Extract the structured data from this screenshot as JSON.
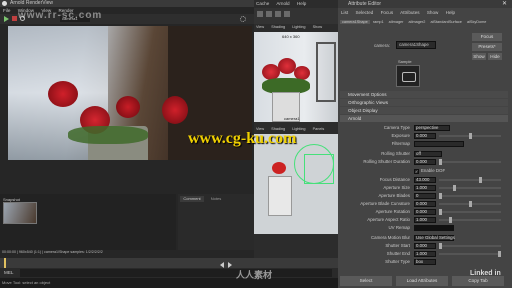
{
  "watermark": {
    "main": "www.cg-ku.com",
    "top_left": "www.rr-sc.com",
    "bottom_center": "人人素材",
    "corner": "Linked in"
  },
  "render_view": {
    "title": "Arnold RenderView",
    "menus": [
      "File",
      "Window",
      "View",
      "Render"
    ],
    "camera": "camera1",
    "status": "00:00:00 | 960x540 (1:1) | camera1/Shape    samples: 1/2/2/2/2/2",
    "tabs": [
      "Comment",
      "Notes"
    ],
    "snapshot": "Snapshot"
  },
  "viewport": {
    "menus": [
      "Cache",
      "Arnold",
      "Help"
    ],
    "menus2": [
      "View",
      "Shading",
      "Lighting",
      "Show",
      "Renderer",
      "Panels"
    ],
    "resolution": "640 x 360",
    "camera": "camera1"
  },
  "attribute_editor": {
    "title": "Attribute Editor",
    "menus": [
      "List",
      "Selected",
      "Focus",
      "Attributes",
      "Show",
      "Help"
    ],
    "tabs": [
      "camera1Shape",
      "ramp1",
      "aiImager",
      "aiImager2",
      "aiStandardSurface",
      "aiSkyDome"
    ],
    "shape_label": "camera:",
    "shape_value": "camera1Shape",
    "buttons": [
      "Focus",
      "Presets*",
      "Show",
      "Hide"
    ],
    "sample_label": "Sample",
    "sections": [
      "Movement Options",
      "Orthographic Views",
      "Object Display",
      "Arnold"
    ],
    "camera_type_label": "Camera Type",
    "camera_type_value": "perspective",
    "rows": [
      {
        "label": "Exposure",
        "value": "0.000"
      },
      {
        "label": "Filtermap",
        "value": ""
      },
      {
        "label": "Rolling Shutter",
        "value": "off"
      },
      {
        "label": "Rolling Shutter Duration",
        "value": "0.000"
      }
    ],
    "enable_dof": "Enable DOF",
    "dof_rows": [
      {
        "label": "Focus Distance",
        "value": "43.000"
      },
      {
        "label": "Aperture Size",
        "value": "1.000"
      },
      {
        "label": "Aperture Blades",
        "value": "0"
      },
      {
        "label": "Aperture Blade Curvature",
        "value": "0.000"
      },
      {
        "label": "Aperture Rotation",
        "value": "0.000"
      },
      {
        "label": "Aperture Aspect Ratio",
        "value": "1.000"
      }
    ],
    "uv_remap_label": "UV Remap",
    "motion_rows": [
      {
        "label": "Camera Motion Blur",
        "value": "Use Global Settings"
      },
      {
        "label": "Shutter Start",
        "value": "0.000"
      },
      {
        "label": "Shutter End",
        "value": "1.000"
      },
      {
        "label": "Shutter Type",
        "value": "box"
      }
    ],
    "bottom_buttons": [
      "Select",
      "Load Attributes",
      "Copy Tab"
    ]
  },
  "bottom_bar": {
    "mel_label": "MEL",
    "help_text": "Move Tool: select an object"
  }
}
